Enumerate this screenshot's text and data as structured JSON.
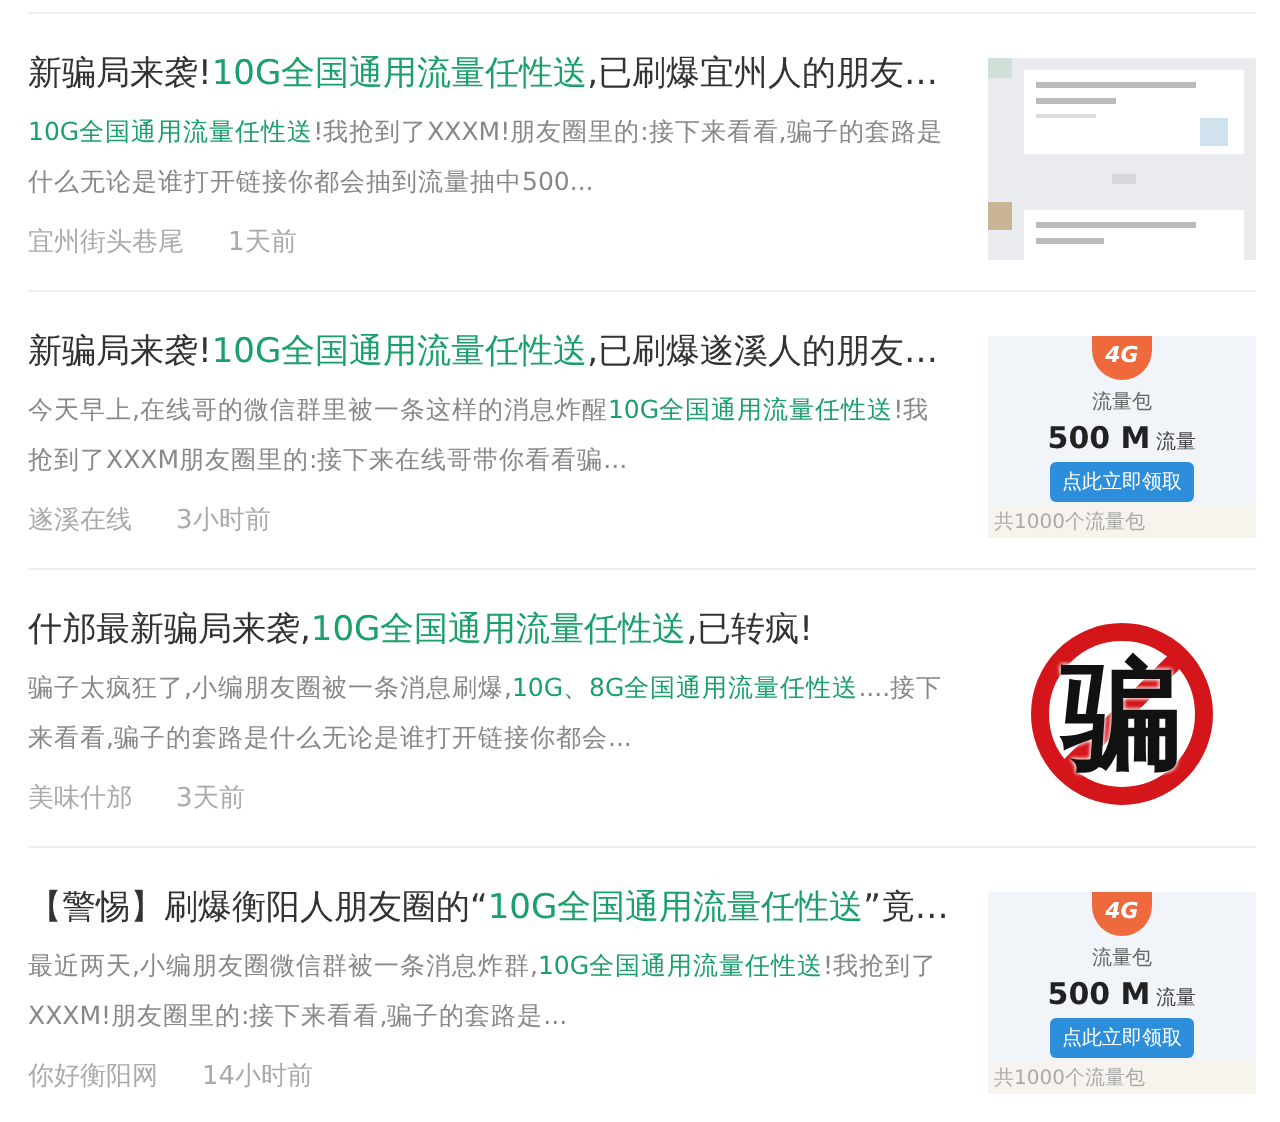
{
  "articles": [
    {
      "title": [
        {
          "text": "新骗局来袭!",
          "highlight": false
        },
        {
          "text": "10G全国通用流量任性送",
          "highlight": true
        },
        {
          "text": ",已刷爆宜州人的朋友…",
          "highlight": false
        }
      ],
      "summary": [
        {
          "text": "10G全国通用流量任性送",
          "highlight": true
        },
        {
          "text": "!我抢到了XXXM!朋友圈里的:接下来看看,骗子的套路是什么无论是谁打开链接你都会抽到流量抽中500...",
          "highlight": false
        }
      ],
      "source": "宜州街头巷尾",
      "time": "1天前",
      "thumbnail": {
        "kind": "chat"
      }
    },
    {
      "title": [
        {
          "text": "新骗局来袭!",
          "highlight": false
        },
        {
          "text": "10G全国通用流量任性送",
          "highlight": true
        },
        {
          "text": ",已刷爆遂溪人的朋友…",
          "highlight": false
        }
      ],
      "summary": [
        {
          "text": "今天早上,在线哥的微信群里被一条这样的消息炸醒",
          "highlight": false
        },
        {
          "text": "10G全国通用流量任性送",
          "highlight": true
        },
        {
          "text": "!我抢到了XXXM朋友圈里的:接下来在线哥带你看看骗...",
          "highlight": false
        }
      ],
      "source": "遂溪在线",
      "time": "3小时前",
      "thumbnail": {
        "kind": "data-pack",
        "badge": "4G",
        "label": "流量包",
        "amount": "500 M",
        "unit": "流量",
        "button": "点此立即领取",
        "footer": "共1000个流量包"
      }
    },
    {
      "title": [
        {
          "text": "什邡最新骗局来袭,",
          "highlight": false
        },
        {
          "text": "10G全国通用流量任性送",
          "highlight": true
        },
        {
          "text": ",已转疯!",
          "highlight": false
        }
      ],
      "summary": [
        {
          "text": "骗子太疯狂了,小编朋友圈被一条消息刷爆,",
          "highlight": false
        },
        {
          "text": "10G、8G全国通用流量任性送",
          "highlight": true
        },
        {
          "text": "....接下来看看,骗子的套路是什么无论是谁打开链接你都会...",
          "highlight": false
        }
      ],
      "source": "美味什邡",
      "time": "3天前",
      "thumbnail": {
        "kind": "no-sign",
        "glyph": "骗"
      }
    },
    {
      "title": [
        {
          "text": "【警惕】刷爆衡阳人朋友圈的“",
          "highlight": false
        },
        {
          "text": "10G全国通用流量任性送",
          "highlight": true
        },
        {
          "text": "”竟…",
          "highlight": false
        }
      ],
      "summary": [
        {
          "text": "最近两天,小编朋友圈微信群被一条消息炸群,",
          "highlight": false
        },
        {
          "text": "10G全国通用流量任性送",
          "highlight": true
        },
        {
          "text": "!我抢到了XXXM!朋友圈里的:接下来看看,骗子的套路是...",
          "highlight": false
        }
      ],
      "source": "你好衡阳网",
      "time": "14小时前",
      "thumbnail": {
        "kind": "data-pack",
        "badge": "4G",
        "label": "流量包",
        "amount": "500 M",
        "unit": "流量",
        "button": "点此立即领取",
        "footer": "共1000个流量包"
      }
    }
  ]
}
